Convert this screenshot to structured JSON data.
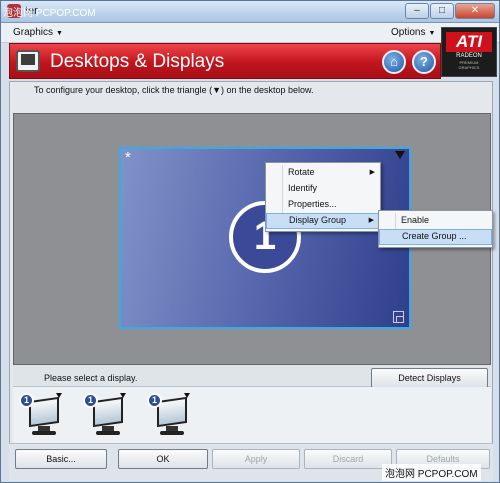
{
  "watermark_top": "泡泡网 PCPOP.COM",
  "watermark_bottom": "泡泡网 PCPOP.COM",
  "title": {
    "text": "ter"
  },
  "window_buttons": [
    "–",
    "□",
    "✕"
  ],
  "menubar": {
    "left": "Graphics",
    "right": "Options"
  },
  "header": {
    "title": "Desktops & Displays",
    "home_icon": "house-icon",
    "help_icon": "help-icon"
  },
  "logo": {
    "word": "ATI",
    "line1": "RADEON",
    "line2": "PREMIUM",
    "line3": "GRAPHICS"
  },
  "instruction": "To configure your desktop, click the triangle (▼) on the desktop below.",
  "display": {
    "star": "*",
    "number": "1"
  },
  "context_menu": {
    "items": [
      {
        "label": "Rotate",
        "submenu": true
      },
      {
        "label": "Identify",
        "submenu": false
      },
      {
        "label": "Properties...",
        "submenu": false
      },
      {
        "label": "Display Group",
        "submenu": true,
        "highlighted": true
      }
    ]
  },
  "sub_menu": {
    "items": [
      {
        "label": "Enable",
        "highlighted": false
      },
      {
        "label": "Create Group ...",
        "highlighted": true
      }
    ]
  },
  "select_label": "Please select a display.",
  "detect_button": "Detect Displays",
  "monitors": [
    {
      "badge": "1"
    },
    {
      "badge": "1"
    },
    {
      "badge": "1"
    }
  ],
  "buttons": {
    "basic": "Basic...",
    "ok": "OK",
    "apply": "Apply",
    "discard": "Discard",
    "defaults": "Defaults"
  },
  "colors": {
    "header_red": "#c0151d",
    "display_border": "#3aa9e8",
    "highlight": "#c7def6"
  }
}
